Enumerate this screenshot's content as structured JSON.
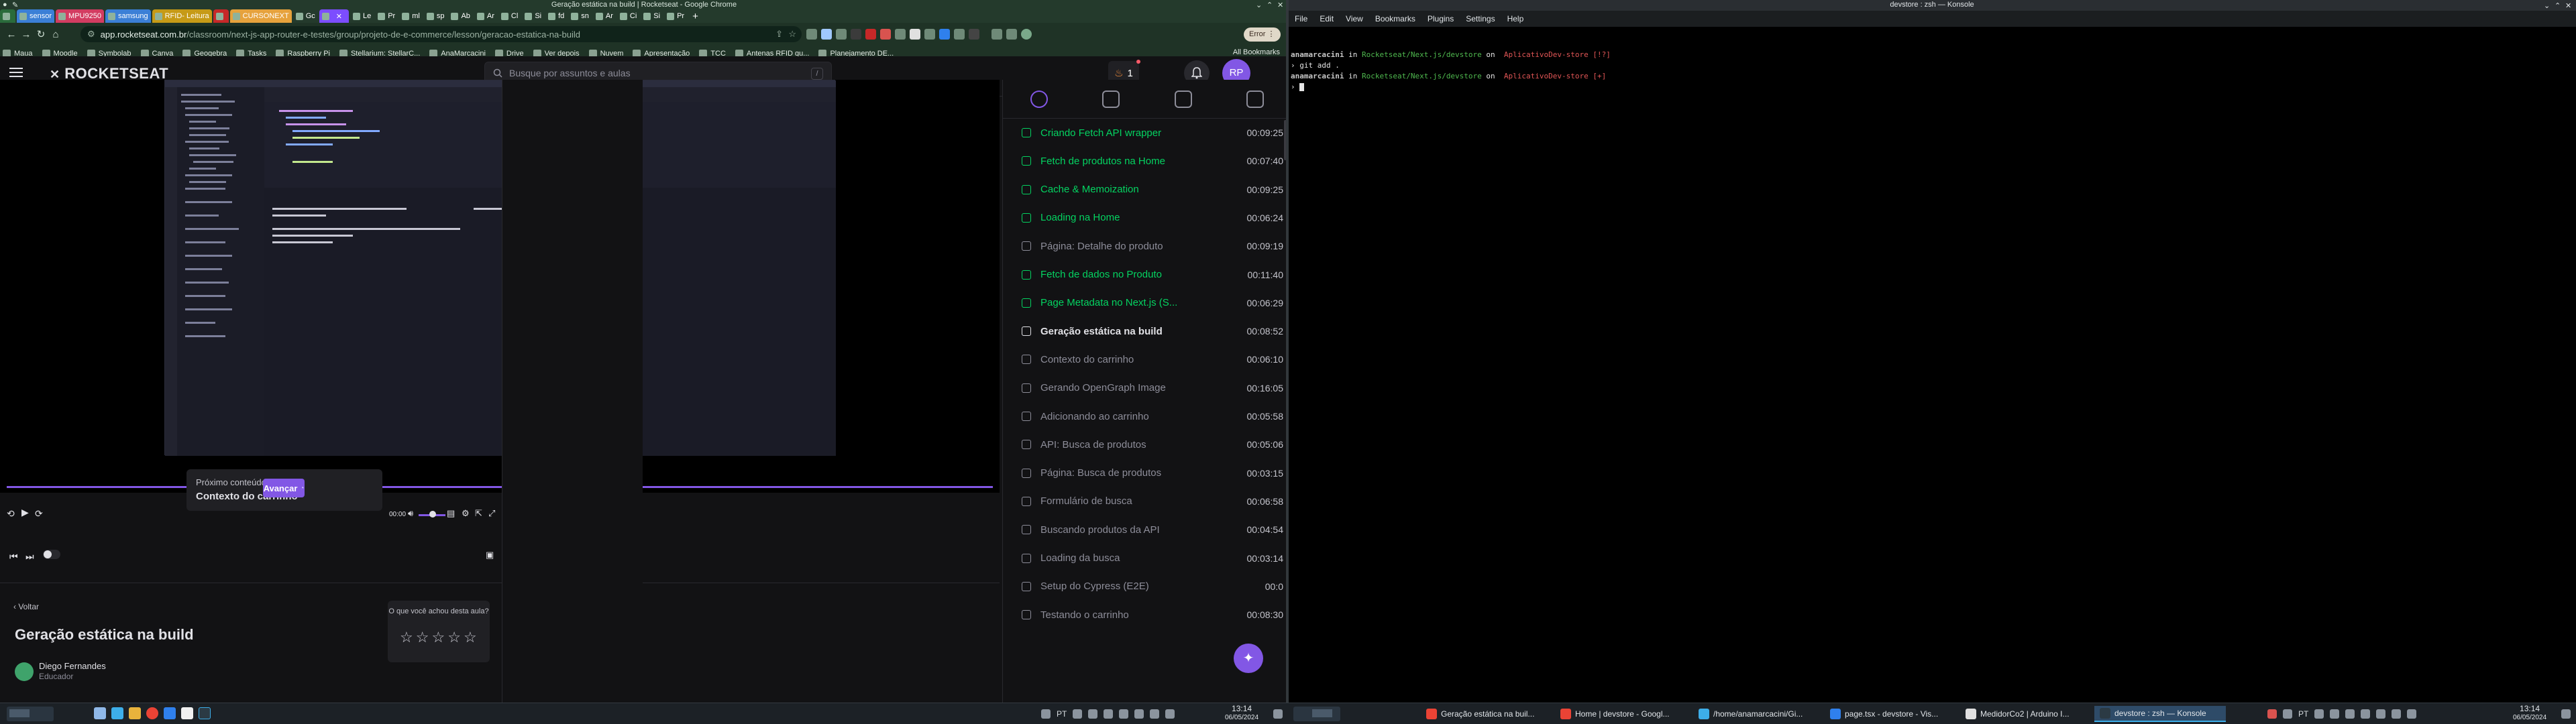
{
  "chrome": {
    "window_title": "Geração estática na build | Rocketseat - Google Chrome",
    "tabs": [
      {
        "label": "",
        "color": "#2a6b3b"
      },
      {
        "label": "sensor",
        "color": "#3b7fd6"
      },
      {
        "label": "MPU9250",
        "color": "#d33c61"
      },
      {
        "label": "samsung",
        "color": "#3b7fd6"
      },
      {
        "label": "RFID- Leitura",
        "color": "#c69a16"
      },
      {
        "label": "",
        "color": "#c62828"
      },
      {
        "label": "CURSONEXT",
        "color": "#e6a23c"
      },
      {
        "label": "Gc",
        "color": ""
      },
      {
        "label": "",
        "color": "#7c4dff"
      },
      {
        "label": "Le",
        "color": ""
      },
      {
        "label": "Pr",
        "color": ""
      },
      {
        "label": "ml",
        "color": ""
      },
      {
        "label": "sp",
        "color": ""
      },
      {
        "label": "Ab",
        "color": ""
      },
      {
        "label": "Ar",
        "color": ""
      },
      {
        "label": "Cl",
        "color": ""
      },
      {
        "label": "Si",
        "color": ""
      },
      {
        "label": "fd",
        "color": ""
      },
      {
        "label": "sn",
        "color": ""
      },
      {
        "label": "Ar",
        "color": ""
      },
      {
        "label": "Ci",
        "color": ""
      },
      {
        "label": "Si",
        "color": ""
      },
      {
        "label": "Pr",
        "color": ""
      }
    ],
    "url_host": "app.rocketseat.com.br",
    "url_path": "/classroom/next-js-app-router-e-testes/group/projeto-de-e-commerce/lesson/geracao-estatica-na-build",
    "error_label": "Error",
    "bookmarks": [
      "Maua",
      "Moodle",
      "Symbolab",
      "Canva",
      "Geogebra",
      "Tasks",
      "Raspberry Pi",
      "Stellarium: StellarC...",
      "AnaMarcacini",
      "Drive",
      "Ver depois",
      "Nuvem",
      "Apresentação",
      "TCC",
      "Antenas RFID qu...",
      "Planejamento DE..."
    ],
    "all_bookmarks": "All Bookmarks"
  },
  "rocketseat": {
    "logo": "ROCKETSEAT",
    "search_placeholder": "Busque por assuntos e aulas",
    "search_shortcut": "/",
    "streak": "1",
    "avatar": "RP",
    "next_content_label": "Próximo conteúdo:",
    "next_content_title": "Contexto do carrinho",
    "advance_button": "Avançar",
    "time": "00:00",
    "back_link": "Voltar",
    "lesson_title": "Geração estática na build",
    "instructor_name": "Diego Fernandes",
    "instructor_role": "Educador",
    "rating_prompt": "O que você achou desta aula?",
    "lessons": [
      {
        "title": "Criando Fetch API wrapper",
        "duration": "00:09:25",
        "state": "done"
      },
      {
        "title": "Fetch de produtos na Home",
        "duration": "00:07:40",
        "state": "done"
      },
      {
        "title": "Cache & Memoization",
        "duration": "00:09:25",
        "state": "done"
      },
      {
        "title": "Loading na Home",
        "duration": "00:06:24",
        "state": "done"
      },
      {
        "title": "Página: Detalhe do produto",
        "duration": "00:09:19",
        "state": "todo"
      },
      {
        "title": "Fetch de dados no Produto",
        "duration": "00:11:40",
        "state": "done"
      },
      {
        "title": "Page Metadata no Next.js (S...",
        "duration": "00:06:29",
        "state": "done"
      },
      {
        "title": "Geração estática na build",
        "duration": "00:08:52",
        "state": "current"
      },
      {
        "title": "Contexto do carrinho",
        "duration": "00:06:10",
        "state": "todo"
      },
      {
        "title": "Gerando OpenGraph Image",
        "duration": "00:16:05",
        "state": "todo"
      },
      {
        "title": "Adicionando ao carrinho",
        "duration": "00:05:58",
        "state": "todo"
      },
      {
        "title": "API: Busca de produtos",
        "duration": "00:05:06",
        "state": "todo"
      },
      {
        "title": "Página: Busca de produtos",
        "duration": "00:03:15",
        "state": "todo"
      },
      {
        "title": "Formulário de busca",
        "duration": "00:06:58",
        "state": "todo"
      },
      {
        "title": "Buscando produtos da API",
        "duration": "00:04:54",
        "state": "todo"
      },
      {
        "title": "Loading da busca",
        "duration": "00:03:14",
        "state": "todo"
      },
      {
        "title": "Setup do Cypress (E2E)",
        "duration": "00:0",
        "state": "todo"
      },
      {
        "title": "Testando o carrinho",
        "duration": "00:08:30",
        "state": "todo"
      }
    ]
  },
  "konsole": {
    "window_title": "devstore : zsh — Konsole",
    "menu": [
      "File",
      "Edit",
      "View",
      "Bookmarks",
      "Plugins",
      "Settings",
      "Help"
    ],
    "line1": {
      "user": "anamarcacini",
      "in": " in ",
      "path": "Rocketseat/Next.js/devstore",
      "on": " on ",
      "branch": " AplicativoDev-store [!?]"
    },
    "cmd1": "› git add .",
    "line2": {
      "user": "anamarcacini",
      "in": " in ",
      "path": "Rocketseat/Next.js/devstore",
      "on": " on ",
      "branch": " AplicativoDev-store [+]"
    },
    "prompt": "› "
  },
  "taskbar": {
    "left_time": "13:14",
    "left_date": "06/05/2024",
    "lang": "PT",
    "items": [
      {
        "label": "Geração estática na buil...",
        "active": false
      },
      {
        "label": "Home | devstore - Googl...",
        "active": false
      },
      {
        "label": "/home/anamarcacini/Gi...",
        "active": false
      },
      {
        "label": "page.tsx - devstore - Vis...",
        "active": false
      },
      {
        "label": "MedidorCo2 | Arduino I...",
        "active": false
      },
      {
        "label": "devstore : zsh — Konsole",
        "active": true
      }
    ],
    "right_time": "13:14",
    "right_date": "06/05/2024"
  }
}
